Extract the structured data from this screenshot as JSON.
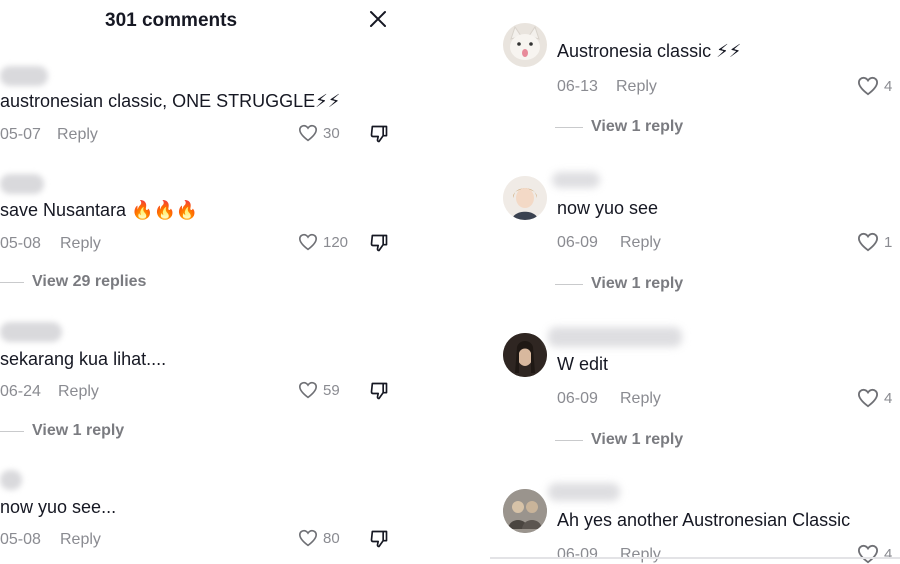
{
  "header": {
    "title": "301 comments"
  },
  "left_comments": [
    {
      "text": "austronesian classic, ONE STRUGGLE⚡⚡",
      "date": "05-07",
      "reply": "Reply",
      "likes": "30"
    },
    {
      "text": "save Nusantara 🔥🔥🔥",
      "date": "05-08",
      "reply": "Reply",
      "likes": "120",
      "view_replies": "View 29 replies"
    },
    {
      "text": "sekarang kua lihat....",
      "date": "06-24",
      "reply": "Reply",
      "likes": "59",
      "view_replies": "View 1 reply"
    },
    {
      "text": "now yuo see...",
      "date": "05-08",
      "reply": "Reply",
      "likes": "80"
    }
  ],
  "right_comments": [
    {
      "text": "Austronesia classic ⚡⚡",
      "date": "06-13",
      "reply": "Reply",
      "likes": "4",
      "view_replies": "View 1 reply",
      "avatar": "cat-avatar"
    },
    {
      "text": "now yuo see",
      "date": "06-09",
      "reply": "Reply",
      "likes": "1",
      "view_replies": "View 1 reply",
      "avatar": "anime-avatar"
    },
    {
      "text": "W edit",
      "date": "06-09",
      "reply": "Reply",
      "likes": "4",
      "view_replies": "View 1 reply",
      "avatar": "dark-hair-avatar"
    },
    {
      "text": "Ah yes another Austronesian Classic",
      "date": "06-09",
      "reply": "Reply",
      "likes": "4",
      "avatar": "group-avatar"
    }
  ],
  "colors": {
    "text": "#161823",
    "muted": "#8a8b91",
    "bolt": "#f5c400"
  }
}
